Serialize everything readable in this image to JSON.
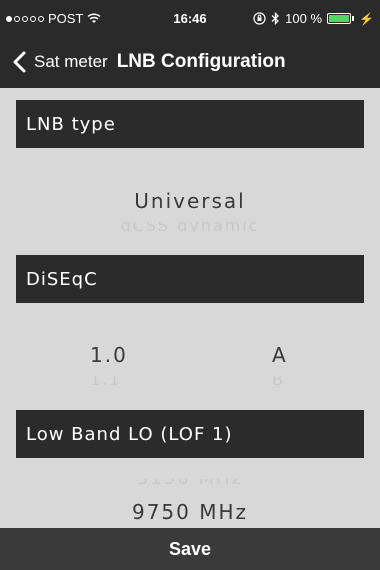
{
  "status_bar": {
    "carrier": "POST",
    "time": "16:46",
    "battery": "100 %",
    "battery_level": 1.0,
    "signal_bars_filled": 1,
    "signal_bars_total": 5
  },
  "nav": {
    "back_label": "Sat meter",
    "title": "LNB Configuration"
  },
  "lnb_type": {
    "header": "LNB type",
    "selected": "Universal",
    "next": "dCSS dynamic"
  },
  "diseqc": {
    "header": "DiSEqC",
    "version_selected": "1.0",
    "version_next": "1.1",
    "port_selected": "A",
    "port_next": "B"
  },
  "low_band": {
    "header": "Low Band LO (LOF 1)",
    "prev": "5150 MHz",
    "selected": "9750 MHz"
  },
  "footer": {
    "save_label": "Save"
  },
  "colors": {
    "bar_bg": "#2a2a2a",
    "page_bg": "#d8d8d8",
    "battery_green": "#4cd964"
  }
}
